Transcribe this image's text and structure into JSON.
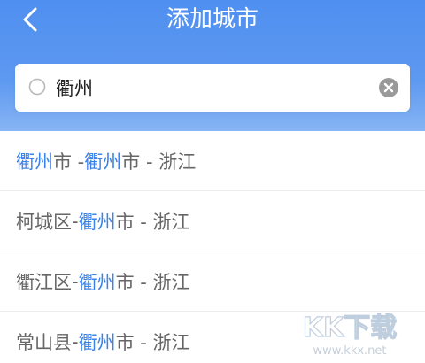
{
  "header": {
    "title": "添加城市",
    "back_icon": "chevron-left-icon"
  },
  "search": {
    "value": "衢州",
    "icon": "search-icon",
    "clear_icon": "clear-icon"
  },
  "results": [
    {
      "part1": "衢州",
      "part1_highlight": true,
      "part2": "市 - ",
      "part3": "衢州",
      "part4": "市 - 浙江"
    },
    {
      "part1": "柯城区",
      "part1_highlight": false,
      "part2": " - ",
      "part3": "衢州",
      "part4": "市 - 浙江"
    },
    {
      "part1": "衢江区",
      "part1_highlight": false,
      "part2": " - ",
      "part3": "衢州",
      "part4": "市 - 浙江"
    },
    {
      "part1": "常山县",
      "part1_highlight": false,
      "part2": " - ",
      "part3": "衢州",
      "part4": "市 - 浙江"
    }
  ],
  "watermark": {
    "logo_text": "KK下载",
    "url": "www.kkx.net"
  },
  "colors": {
    "header": "#4f8ff0",
    "highlight": "#3b83ea",
    "text": "#666666"
  }
}
